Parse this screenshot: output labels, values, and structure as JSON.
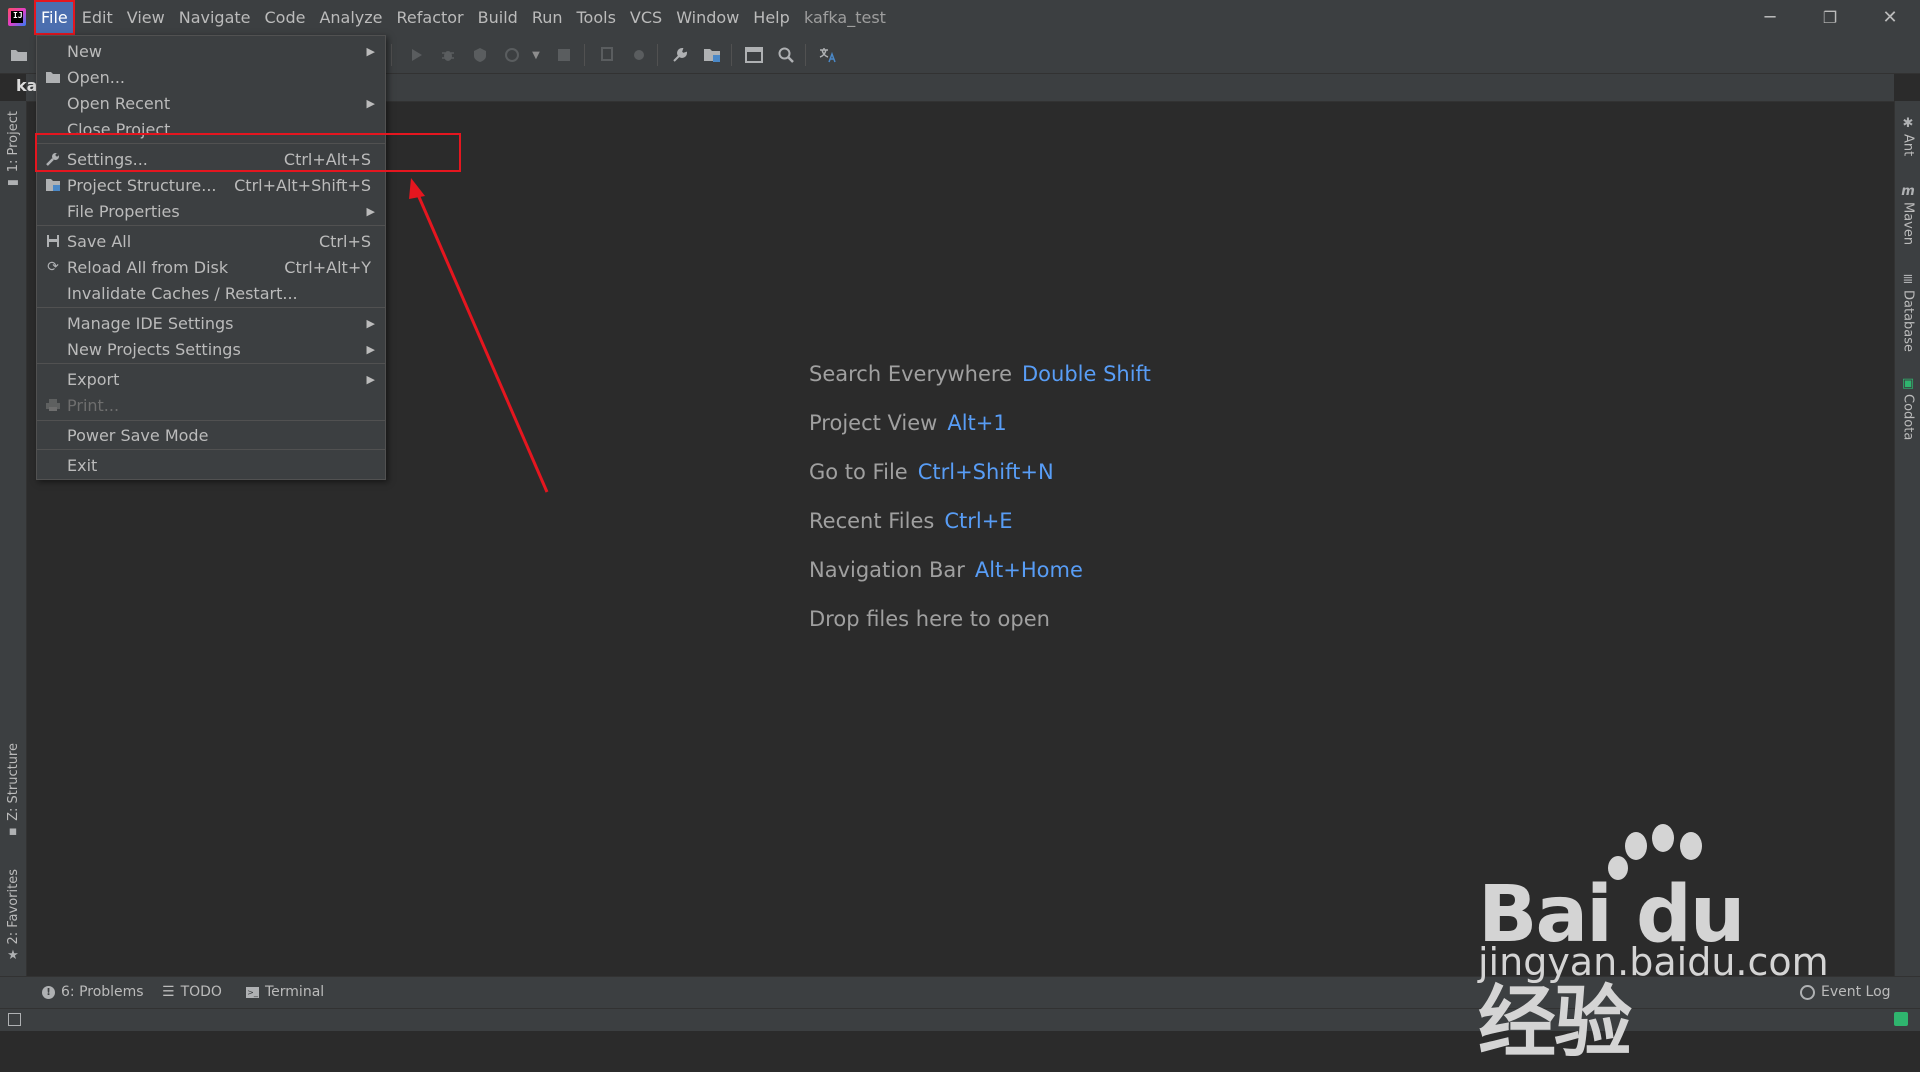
{
  "app": {
    "window_title": "kafka_test",
    "logo_letters": "IJ"
  },
  "menubar": {
    "items": [
      "File",
      "Edit",
      "View",
      "Navigate",
      "Code",
      "Analyze",
      "Refactor",
      "Build",
      "Run",
      "Tools",
      "VCS",
      "Window",
      "Help"
    ],
    "active": "File"
  },
  "window_controls": {
    "minimize": "─",
    "restore": "❐",
    "close": "✕"
  },
  "navbar": {
    "project_label": "kaf"
  },
  "left_strip": {
    "project_tab": "1: Project",
    "structure_tab": "Z: Structure",
    "favorites_tab": "2: Favorites"
  },
  "right_strip": {
    "ant_tab": "Ant",
    "maven_tab": "Maven",
    "database_tab": "Database",
    "codota_tab": "Codota"
  },
  "file_menu": {
    "new": "New",
    "open": "Open...",
    "open_recent": "Open Recent",
    "close_project": "Close Project",
    "settings": "Settings...",
    "settings_shortcut": "Ctrl+Alt+S",
    "project_structure": "Project Structure...",
    "project_structure_shortcut": "Ctrl+Alt+Shift+S",
    "file_properties": "File Properties",
    "save_all": "Save All",
    "save_all_shortcut": "Ctrl+S",
    "reload_all": "Reload All from Disk",
    "reload_all_shortcut": "Ctrl+Alt+Y",
    "invalidate_caches": "Invalidate Caches / Restart...",
    "manage_ide_settings": "Manage IDE Settings",
    "new_projects_settings": "New Projects Settings",
    "export": "Export",
    "print": "Print...",
    "power_save_mode": "Power Save Mode",
    "exit": "Exit"
  },
  "editor_hints": {
    "search_everywhere": "Search Everywhere",
    "search_everywhere_key": "Double Shift",
    "project_view": "Project View",
    "project_view_key": "Alt+1",
    "go_to_file": "Go to File",
    "go_to_file_key": "Ctrl+Shift+N",
    "recent_files": "Recent Files",
    "recent_files_key": "Ctrl+E",
    "navigation_bar": "Navigation Bar",
    "navigation_bar_key": "Alt+Home",
    "drop_files": "Drop files here to open"
  },
  "bottom_bar": {
    "problems": "6: Problems",
    "todo": "TODO",
    "terminal": "Terminal",
    "event_log": "Event Log"
  },
  "watermark": {
    "brand": "Bai du 经验",
    "url": "jingyan.baidu.com"
  },
  "colors": {
    "accent_blue": "#589df6",
    "annotation_red": "#e5161f",
    "menu_highlight": "#4b6eaf"
  }
}
